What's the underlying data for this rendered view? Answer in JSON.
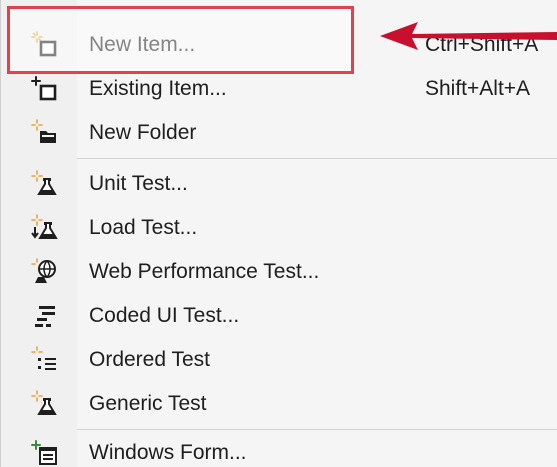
{
  "menu": {
    "items": [
      {
        "label": "New Item...",
        "shortcut": "Ctrl+Shift+A",
        "icon": "new-item-icon"
      },
      {
        "label": "Existing Item...",
        "shortcut": "Shift+Alt+A",
        "icon": "existing-item-icon"
      },
      {
        "label": "New Folder",
        "shortcut": "",
        "icon": "new-folder-icon"
      },
      {
        "label": "Unit Test...",
        "shortcut": "",
        "icon": "unit-test-icon"
      },
      {
        "label": "Load Test...",
        "shortcut": "",
        "icon": "load-test-icon"
      },
      {
        "label": "Web Performance Test...",
        "shortcut": "",
        "icon": "web-performance-test-icon"
      },
      {
        "label": "Coded UI Test...",
        "shortcut": "",
        "icon": "coded-ui-test-icon"
      },
      {
        "label": "Ordered Test",
        "shortcut": "",
        "icon": "ordered-test-icon"
      },
      {
        "label": "Generic Test",
        "shortcut": "",
        "icon": "generic-test-icon"
      },
      {
        "label": "Windows Form...",
        "shortcut": "",
        "icon": "windows-form-icon"
      }
    ]
  },
  "annotation": {
    "highlight_color": "#e0434e",
    "arrow_color": "#c8102e"
  },
  "colors": {
    "menu_background": "#f5f5f5",
    "text": "#1e1e1e",
    "separator": "#d4d4d4",
    "sparkle": "#e8a33a"
  }
}
